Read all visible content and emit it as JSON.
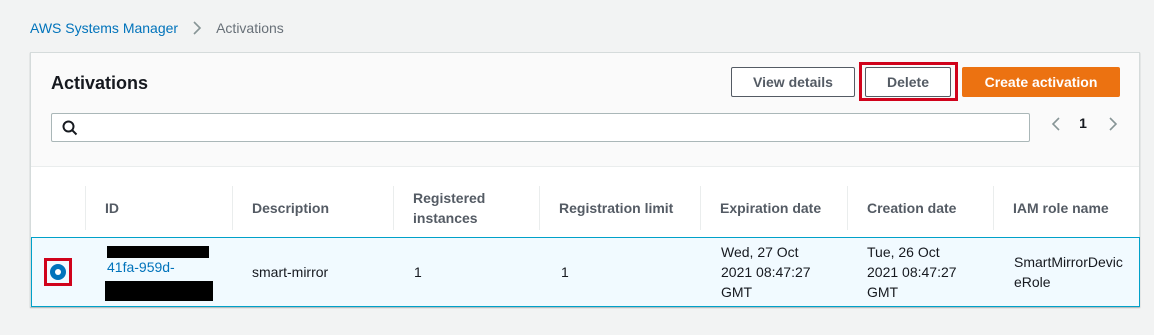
{
  "breadcrumb": {
    "parent": "AWS Systems Manager",
    "current": "Activations"
  },
  "panel": {
    "title": "Activations",
    "buttons": {
      "view_details": "View details",
      "delete": "Delete",
      "create": "Create activation"
    }
  },
  "search": {
    "value": "",
    "placeholder": ""
  },
  "pagination": {
    "current_page": "1"
  },
  "table": {
    "columns": [
      "ID",
      "Description",
      "Registered instances",
      "Registration limit",
      "Expiration date",
      "Creation date",
      "IAM role name"
    ],
    "rows": [
      {
        "selected": true,
        "id_visible": "41fa-959d-",
        "description": "smart-mirror",
        "registered_instances": "1",
        "registration_limit": "1",
        "expiration_date": "Wed, 27 Oct 2021 08:47:27 GMT",
        "creation_date": "Tue, 26 Oct 2021 08:47:27 GMT",
        "iam_role": "SmartMirrorDeviceRole"
      }
    ]
  },
  "colors": {
    "link": "#0073bb",
    "primary_button": "#ec7211",
    "highlight": "#d0021b",
    "selected_row_bg": "#f1faff",
    "selected_row_border": "#00a1c9"
  }
}
